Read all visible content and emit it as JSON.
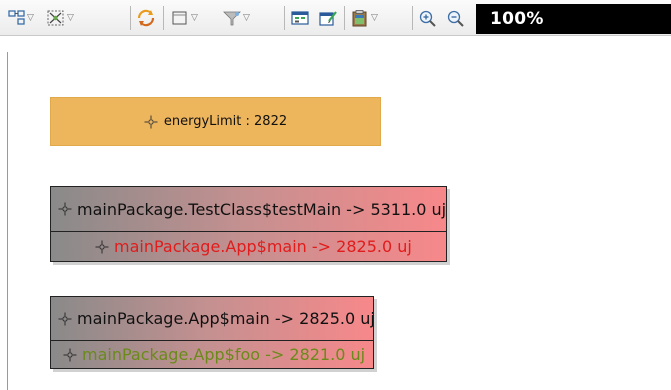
{
  "toolbar": {
    "buttons": [
      {
        "name": "layout-icon",
        "dropdown": true
      },
      {
        "name": "select-all-icon",
        "dropdown": true
      },
      {
        "name": "refresh-icon",
        "dropdown": false
      },
      {
        "name": "node-shape-icon",
        "dropdown": true
      },
      {
        "name": "filter-icon",
        "dropdown": true
      },
      {
        "name": "show-table-icon",
        "dropdown": false
      },
      {
        "name": "edit-table-icon",
        "dropdown": false
      },
      {
        "name": "clipboard-icon",
        "dropdown": true
      },
      {
        "name": "zoom-in-icon",
        "dropdown": false
      },
      {
        "name": "zoom-out-icon",
        "dropdown": false
      }
    ],
    "zoom_level": "100%"
  },
  "graph": {
    "energy_node": {
      "label": "energyLimit : 2822",
      "color": "#edb55c"
    },
    "groups": [
      {
        "rows": [
          {
            "label": "mainPackage.TestClass$testMain -> 5311.0 uj",
            "text_color": "#111111"
          },
          {
            "label": "mainPackage.App$main -> 2825.0 uj",
            "text_color": "#e01c1c"
          }
        ]
      },
      {
        "rows": [
          {
            "label": "mainPackage.App$main -> 2825.0 uj",
            "text_color": "#111111"
          },
          {
            "label": "mainPackage.App$foo -> 2821.0 uj",
            "text_color": "#6a8a1a"
          }
        ]
      }
    ]
  }
}
